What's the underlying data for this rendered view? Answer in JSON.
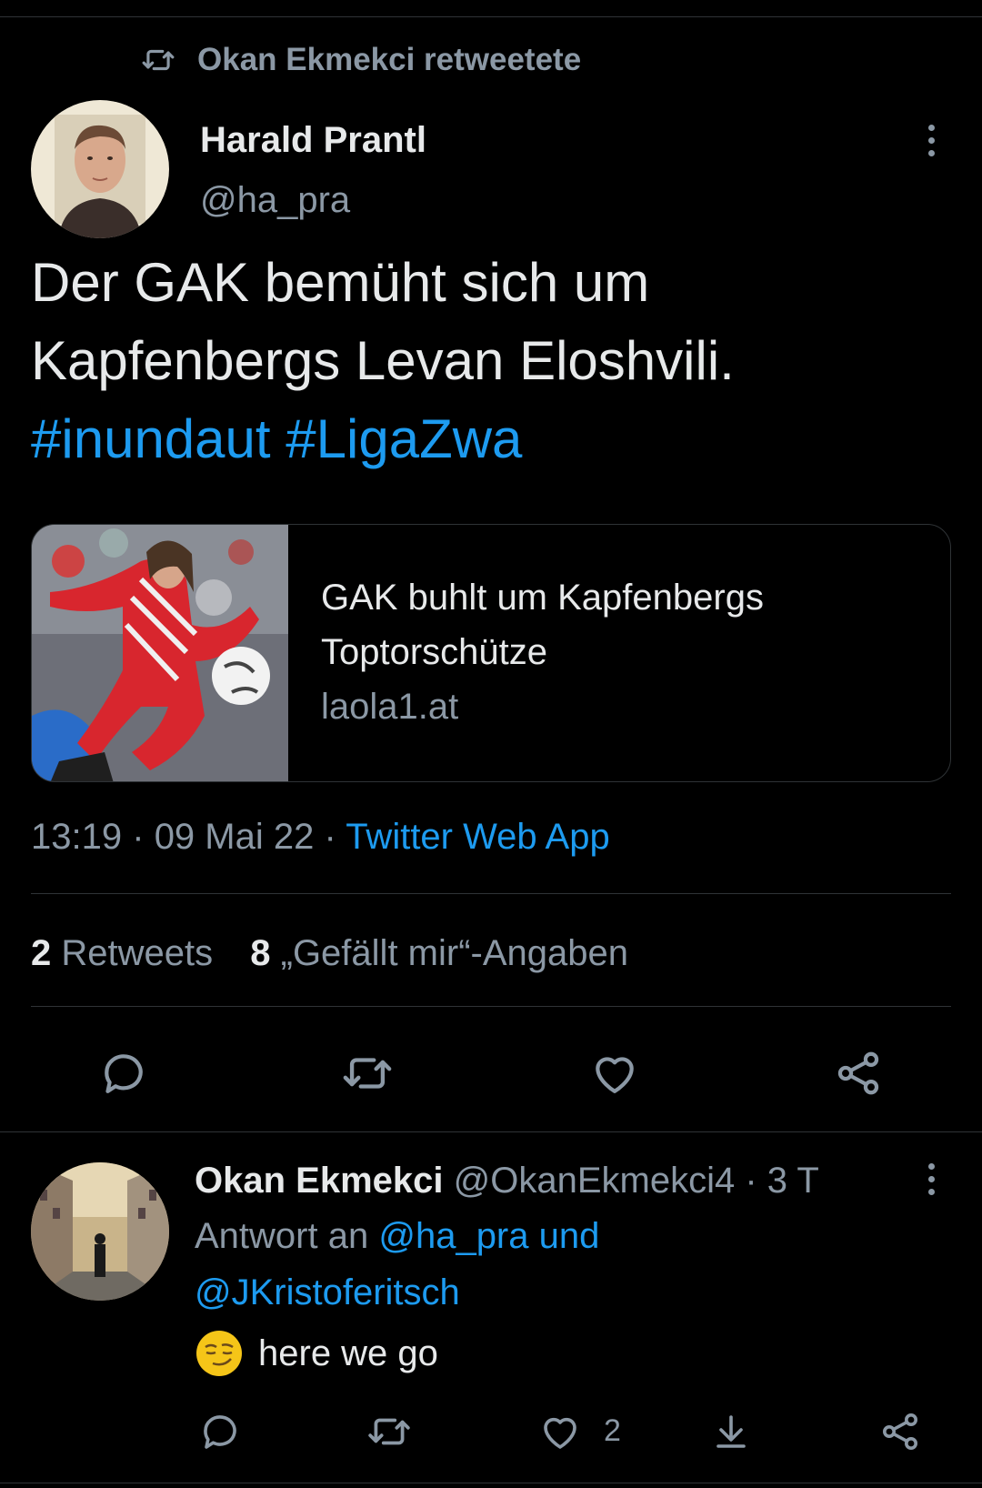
{
  "retweet_context": {
    "icon": "retweet-icon",
    "text": "Okan Ekmekci retweetete"
  },
  "tweet": {
    "author_name": "Harald Prantl",
    "author_handle": "@ha_pra",
    "text_line1": "Der GAK bemüht sich um",
    "text_line2": "Kapfenbergs Levan Eloshvili.",
    "hashtag1": "#inundaut",
    "hashtag2": "#LigaZwa",
    "card": {
      "title_line1": "GAK buhlt um Kapfenbergs",
      "title_line2": "Toptorschütze",
      "domain": "laola1.at"
    },
    "time": "13:19",
    "date": "09 Mai 22",
    "separator": "·",
    "source": "Twitter Web App",
    "retweet_count": "2",
    "retweet_label": "Retweets",
    "like_count": "8",
    "like_label": "„Gefällt mir“-Angaben",
    "actions": [
      "reply-icon",
      "retweet-icon",
      "like-icon",
      "share-icon"
    ]
  },
  "reply": {
    "author_name": "Okan Ekmekci",
    "author_handle": "@OkanEkmekci4",
    "time_ago": "3 T",
    "separator": "·",
    "reply_prefix": "Antwort an",
    "mention1": "@ha_pra und",
    "mention2": "@JKristoferitsch",
    "emoji": "smirking-face-emoji",
    "text": "here we go",
    "like_count": "2",
    "actions": [
      "reply-icon",
      "retweet-icon",
      "like-icon",
      "download-icon",
      "share-icon"
    ]
  },
  "colors": {
    "background": "#000000",
    "text": "#e7e9ea",
    "muted": "#8b98a5",
    "link": "#1d9bf0",
    "divider": "#2f3336"
  }
}
